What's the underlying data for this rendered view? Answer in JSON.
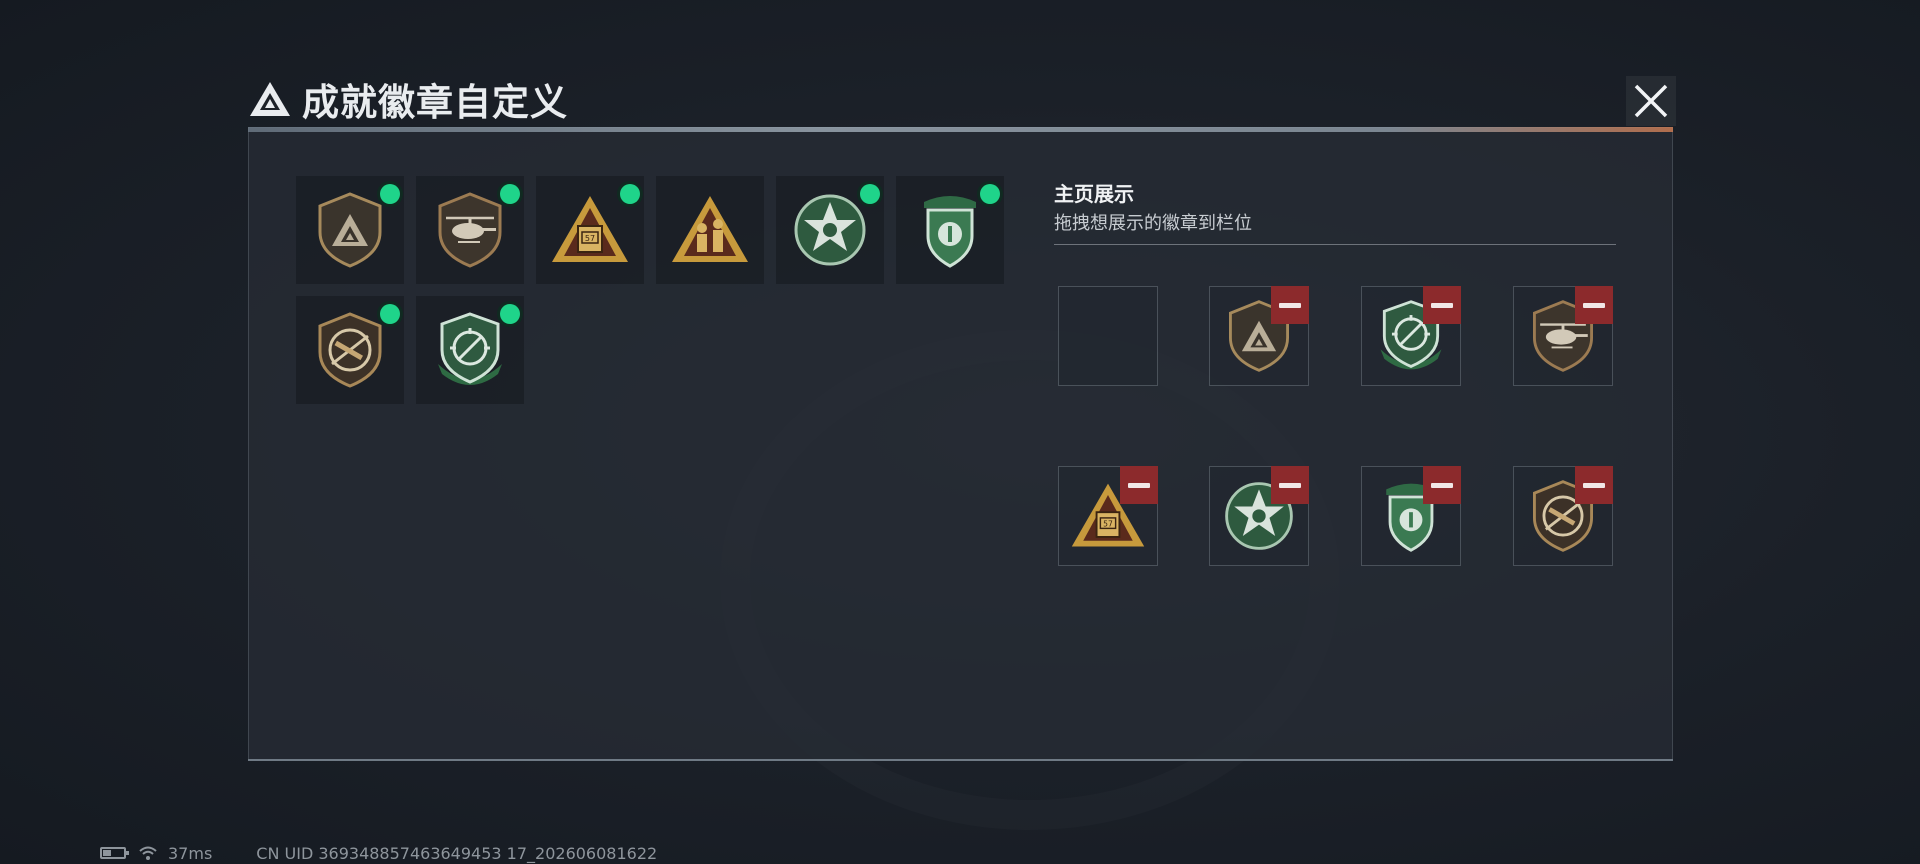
{
  "window": {
    "title": "成就徽章自定义",
    "close_icon": "close-icon"
  },
  "inventory": {
    "badges": [
      {
        "icon": "shield-logo-badge",
        "is_new": true
      },
      {
        "icon": "helicopter-shield-badge",
        "is_new": true
      },
      {
        "icon": "gold-crate-triangle-badge",
        "is_new": true
      },
      {
        "icon": "gold-soldiers-triangle-badge",
        "is_new": false
      },
      {
        "icon": "green-star-skull-badge",
        "is_new": true
      },
      {
        "icon": "green-beret-shield-badge",
        "is_new": true
      },
      {
        "icon": "rifle-prohibited-badge",
        "is_new": true
      },
      {
        "icon": "green-crosshair-shield-badge",
        "is_new": true
      }
    ]
  },
  "display": {
    "title": "主页展示",
    "subtitle": "拖拽想展示的徽章到栏位",
    "slots": [
      {
        "icon": "",
        "removable": false
      },
      {
        "icon": "shield-logo-badge",
        "removable": true
      },
      {
        "icon": "green-crosshair-shield-badge",
        "removable": true
      },
      {
        "icon": "helicopter-shield-badge",
        "removable": true
      },
      {
        "icon": "gold-crate-triangle-badge",
        "removable": true
      },
      {
        "icon": "green-star-skull-badge",
        "removable": true
      },
      {
        "icon": "green-beret-shield-badge",
        "removable": true
      },
      {
        "icon": "rifle-prohibited-badge",
        "removable": true
      }
    ]
  },
  "status": {
    "ping": "37ms",
    "uid": "CN UID 369348857463649453 17_202606081622"
  },
  "colors": {
    "new_dot": "#1fd48a",
    "remove_button": "#8c2a2c",
    "panel_bg": "#262c34"
  }
}
